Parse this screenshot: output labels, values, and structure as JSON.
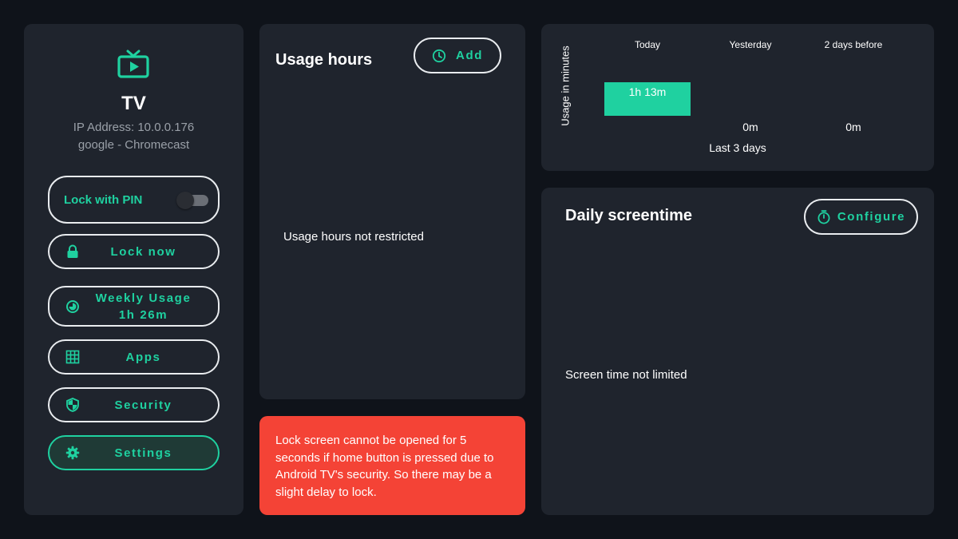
{
  "device": {
    "name": "TV",
    "ip_address": "IP Address: 10.0.0.176",
    "model": "google - Chromecast",
    "icon": "tv-icon"
  },
  "controls": {
    "lock_with_pin_label": "Lock with PIN",
    "lock_with_pin_enabled": false,
    "lock_now_label": "Lock now",
    "weekly_usage_label": "Weekly Usage",
    "weekly_usage_value": "1h 26m",
    "apps_label": "Apps",
    "security_label": "Security",
    "settings_label": "Settings"
  },
  "usage_hours": {
    "title": "Usage hours",
    "add_label": "Add",
    "empty_text": "Usage hours not restricted"
  },
  "warning": {
    "text": "Lock screen cannot be opened for 5 seconds if home button is pressed due to Android TV's security. So there may be a slight delay to lock."
  },
  "chart_data": {
    "type": "bar",
    "categories": [
      "Today",
      "Yesterday",
      "2 days before"
    ],
    "values": [
      73,
      0,
      0
    ],
    "value_labels": [
      "1h 13m",
      "0m",
      "0m"
    ],
    "title": "",
    "xlabel": "Last 3 days",
    "ylabel": "Usage in minutes",
    "ylim": [
      0,
      73
    ],
    "grid": false,
    "bar_color": "#1fd1a0"
  },
  "screentime": {
    "title": "Daily screentime",
    "configure_label": "Configure",
    "empty_text": "Screen time not limited"
  },
  "colors": {
    "accent": "#1fd1a0",
    "background": "#0f131a",
    "panel": "#1f242d",
    "warning": "#f44336"
  }
}
